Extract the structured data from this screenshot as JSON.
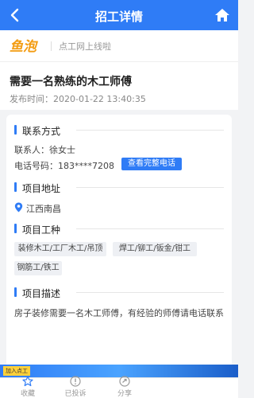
{
  "header": {
    "title": "招工详情"
  },
  "banner": {
    "logo_text": "鱼泡",
    "slogan": "点工网上线啦"
  },
  "job": {
    "title": "需要一名熟练的木工师傅",
    "published": "发布时间：2020-01-22 13:40:35"
  },
  "contact": {
    "section_label": "联系方式",
    "person": "联系人：徐女士",
    "phone": "电话号码：183****7208",
    "view_button": "查看完整电话"
  },
  "address": {
    "section_label": "项目地址",
    "value": "江西南昌"
  },
  "work_types": {
    "section_label": "项目工种",
    "tags": [
      "装修木工/工厂木工/吊顶",
      "焊工/铆工/钣金/钳工",
      "钢筋工/铁工"
    ]
  },
  "description": {
    "section_label": "项目描述",
    "text": "房子装修需要一名木工师傅，有经验的师傅请电话联系"
  },
  "ad": {
    "badge": "加入点工"
  },
  "tabbar": {
    "items": [
      "收藏",
      "已投诉",
      "分享"
    ]
  },
  "colors": {
    "accent": "#2f7cf6",
    "logo": "#f39c12"
  }
}
